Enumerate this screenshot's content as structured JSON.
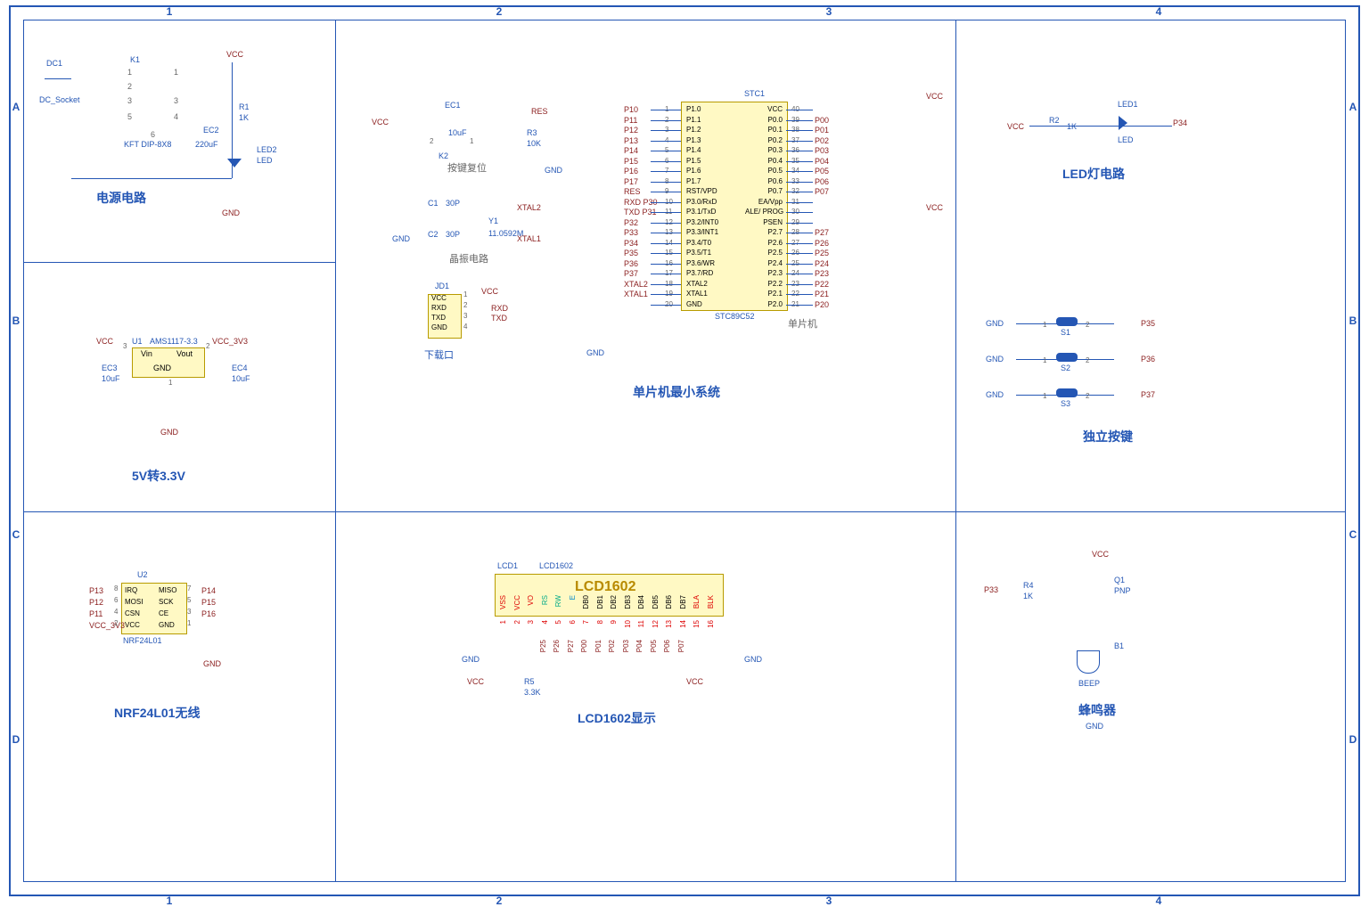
{
  "sheet": {
    "cols": [
      "1",
      "2",
      "3",
      "4"
    ],
    "rows": [
      "A",
      "B",
      "C",
      "D"
    ]
  },
  "sections": {
    "power": {
      "title": "电源电路"
    },
    "vreg": {
      "title": "5V转3.3V"
    },
    "nrf": {
      "title": "NRF24L01无线"
    },
    "reset": {
      "title": "按键复位"
    },
    "xtal": {
      "title": "晶振电路"
    },
    "download": {
      "title": "下载口"
    },
    "mcu": {
      "title": "单片机最小系统"
    },
    "mcu_chip_label": "单片机",
    "lcd": {
      "title": "LCD1602显示"
    },
    "led": {
      "title": "LED灯电路"
    },
    "buttons": {
      "title": "独立按键"
    },
    "buzzer": {
      "title": "蜂鸣器"
    }
  },
  "parts": {
    "DC1": {
      "ref": "DC1",
      "type": "DC_Socket"
    },
    "K1": {
      "ref": "K1",
      "type": "KFT DIP-8X8"
    },
    "EC2": {
      "ref": "EC2",
      "value": "220uF"
    },
    "R1": {
      "ref": "R1",
      "value": "1K"
    },
    "LED2": {
      "ref": "LED2",
      "type": "LED"
    },
    "U1": {
      "ref": "U1",
      "type": "AMS1117-3.3",
      "pins": {
        "3": "Vin",
        "2": "Vout",
        "1": "GND"
      }
    },
    "EC3": {
      "ref": "EC3",
      "value": "10uF"
    },
    "EC4": {
      "ref": "EC4",
      "value": "10uF"
    },
    "U2": {
      "ref": "U2",
      "type": "NRF24L01",
      "pins_left": [
        "IRQ",
        "MOSI",
        "CSN",
        "VCC"
      ],
      "pins_right": [
        "MISO",
        "SCK",
        "CE",
        "GND"
      ]
    },
    "EC1": {
      "ref": "EC1",
      "value": "10uF"
    },
    "K2": {
      "ref": "K2"
    },
    "R3": {
      "ref": "R3",
      "value": "10K"
    },
    "C1": {
      "ref": "C1",
      "value": "30P"
    },
    "C2": {
      "ref": "C2",
      "value": "30P"
    },
    "Y1": {
      "ref": "Y1",
      "value": "11.0592M"
    },
    "JD1": {
      "ref": "JD1",
      "pins": [
        "VCC",
        "RXD",
        "TXD",
        "GND"
      ]
    },
    "STC1": {
      "ref": "STC1",
      "type": "STC89C52"
    },
    "R2": {
      "ref": "R2",
      "value": "1K"
    },
    "LED1": {
      "ref": "LED1",
      "type": "LED"
    },
    "S1": {
      "ref": "S1"
    },
    "S2": {
      "ref": "S2"
    },
    "S3": {
      "ref": "S3"
    },
    "R4": {
      "ref": "R4",
      "value": "1K"
    },
    "Q1": {
      "ref": "Q1",
      "type": "PNP"
    },
    "B1": {
      "ref": "B1",
      "type": "BEEP"
    },
    "R5": {
      "ref": "R5",
      "value": "3.3K"
    },
    "LCD1": {
      "ref": "LCD1",
      "type": "LCD1602",
      "banner": "LCD1602",
      "pins": [
        "VSS",
        "VCC",
        "VO",
        "RS",
        "RW",
        "E",
        "DB0",
        "DB1",
        "DB2",
        "DB3",
        "DB4",
        "DB5",
        "DB6",
        "DB7",
        "BLA",
        "BLK"
      ]
    }
  },
  "nets": {
    "VCC": "VCC",
    "GND": "GND",
    "RES": "RES",
    "VCC_3V3": "VCC_3V3",
    "XTAL1": "XTAL1",
    "XTAL2": "XTAL2",
    "RXD": "RXD",
    "TXD": "TXD",
    "P10": "P10",
    "P11": "P11",
    "P12": "P12",
    "P13": "P13",
    "P14": "P14",
    "P15": "P15",
    "P16": "P16",
    "P17": "P17",
    "P20": "P20",
    "P21": "P21",
    "P22": "P22",
    "P23": "P23",
    "P24": "P24",
    "P25": "P25",
    "P26": "P26",
    "P27": "P27",
    "P30": "P30",
    "P31": "P31",
    "P32": "P32",
    "P33": "P33",
    "P34": "P34",
    "P35": "P35",
    "P36": "P36",
    "P37": "P37",
    "P00": "P00",
    "P01": "P01",
    "P02": "P02",
    "P03": "P03",
    "P04": "P04",
    "P05": "P05",
    "P06": "P06",
    "P07": "P07"
  },
  "mcu_pins_left": [
    {
      "num": "1",
      "name": "P1.0",
      "net": "P10"
    },
    {
      "num": "2",
      "name": "P1.1",
      "net": "P11"
    },
    {
      "num": "3",
      "name": "P1.2",
      "net": "P12"
    },
    {
      "num": "4",
      "name": "P1.3",
      "net": "P13"
    },
    {
      "num": "5",
      "name": "P1.4",
      "net": "P14"
    },
    {
      "num": "6",
      "name": "P1.5",
      "net": "P15"
    },
    {
      "num": "7",
      "name": "P1.6",
      "net": "P16"
    },
    {
      "num": "8",
      "name": "P1.7",
      "net": "P17"
    },
    {
      "num": "9",
      "name": "RST/VPD",
      "net": "RES"
    },
    {
      "num": "10",
      "name": "P3.0/RxD",
      "net": "RXD P30"
    },
    {
      "num": "11",
      "name": "P3.1/TxD",
      "net": "TXD P31"
    },
    {
      "num": "12",
      "name": "P3.2/INT0",
      "net": "P32"
    },
    {
      "num": "13",
      "name": "P3.3/INT1",
      "net": "P33"
    },
    {
      "num": "14",
      "name": "P3.4/T0",
      "net": "P34"
    },
    {
      "num": "15",
      "name": "P3.5/T1",
      "net": "P35"
    },
    {
      "num": "16",
      "name": "P3.6/WR",
      "net": "P36"
    },
    {
      "num": "17",
      "name": "P3.7/RD",
      "net": "P37"
    },
    {
      "num": "18",
      "name": "XTAL2",
      "net": "XTAL2"
    },
    {
      "num": "19",
      "name": "XTAL1",
      "net": "XTAL1"
    },
    {
      "num": "20",
      "name": "GND",
      "net": ""
    }
  ],
  "mcu_pins_right": [
    {
      "num": "40",
      "name": "VCC",
      "net": ""
    },
    {
      "num": "39",
      "name": "P0.0",
      "net": "P00"
    },
    {
      "num": "38",
      "name": "P0.1",
      "net": "P01"
    },
    {
      "num": "37",
      "name": "P0.2",
      "net": "P02"
    },
    {
      "num": "36",
      "name": "P0.3",
      "net": "P03"
    },
    {
      "num": "35",
      "name": "P0.4",
      "net": "P04"
    },
    {
      "num": "34",
      "name": "P0.5",
      "net": "P05"
    },
    {
      "num": "33",
      "name": "P0.6",
      "net": "P06"
    },
    {
      "num": "32",
      "name": "P0.7",
      "net": "P07"
    },
    {
      "num": "31",
      "name": "EA/Vpp",
      "net": ""
    },
    {
      "num": "30",
      "name": "ALE/ PROG",
      "net": ""
    },
    {
      "num": "29",
      "name": "PSEN",
      "net": ""
    },
    {
      "num": "28",
      "name": "P2.7",
      "net": "P27"
    },
    {
      "num": "27",
      "name": "P2.6",
      "net": "P26"
    },
    {
      "num": "26",
      "name": "P2.5",
      "net": "P25"
    },
    {
      "num": "25",
      "name": "P2.4",
      "net": "P24"
    },
    {
      "num": "24",
      "name": "P2.3",
      "net": "P23"
    },
    {
      "num": "23",
      "name": "P2.2",
      "net": "P22"
    },
    {
      "num": "22",
      "name": "P2.1",
      "net": "P21"
    },
    {
      "num": "21",
      "name": "P2.0",
      "net": "P20"
    }
  ],
  "lcd_nets": [
    "",
    "",
    "",
    "P25",
    "P26",
    "P27",
    "P00",
    "P01",
    "P02",
    "P03",
    "P04",
    "P05",
    "P06",
    "P07",
    "",
    ""
  ],
  "u2_nets_left": [
    "P13",
    "P12",
    "P11",
    "VCC_3V3"
  ],
  "u2_nets_right": [
    "P14",
    "P15",
    "P16",
    ""
  ],
  "u2_pin_nums_left": [
    "8",
    "6",
    "4",
    "2"
  ],
  "u2_pin_nums_right": [
    "7",
    "5",
    "3",
    "1"
  ],
  "button_nets": [
    "P35",
    "P36",
    "P37"
  ],
  "switch_pins": {
    "1": "1",
    "2": "2",
    "3": "3",
    "4": "4",
    "5": "5",
    "6": "6"
  }
}
